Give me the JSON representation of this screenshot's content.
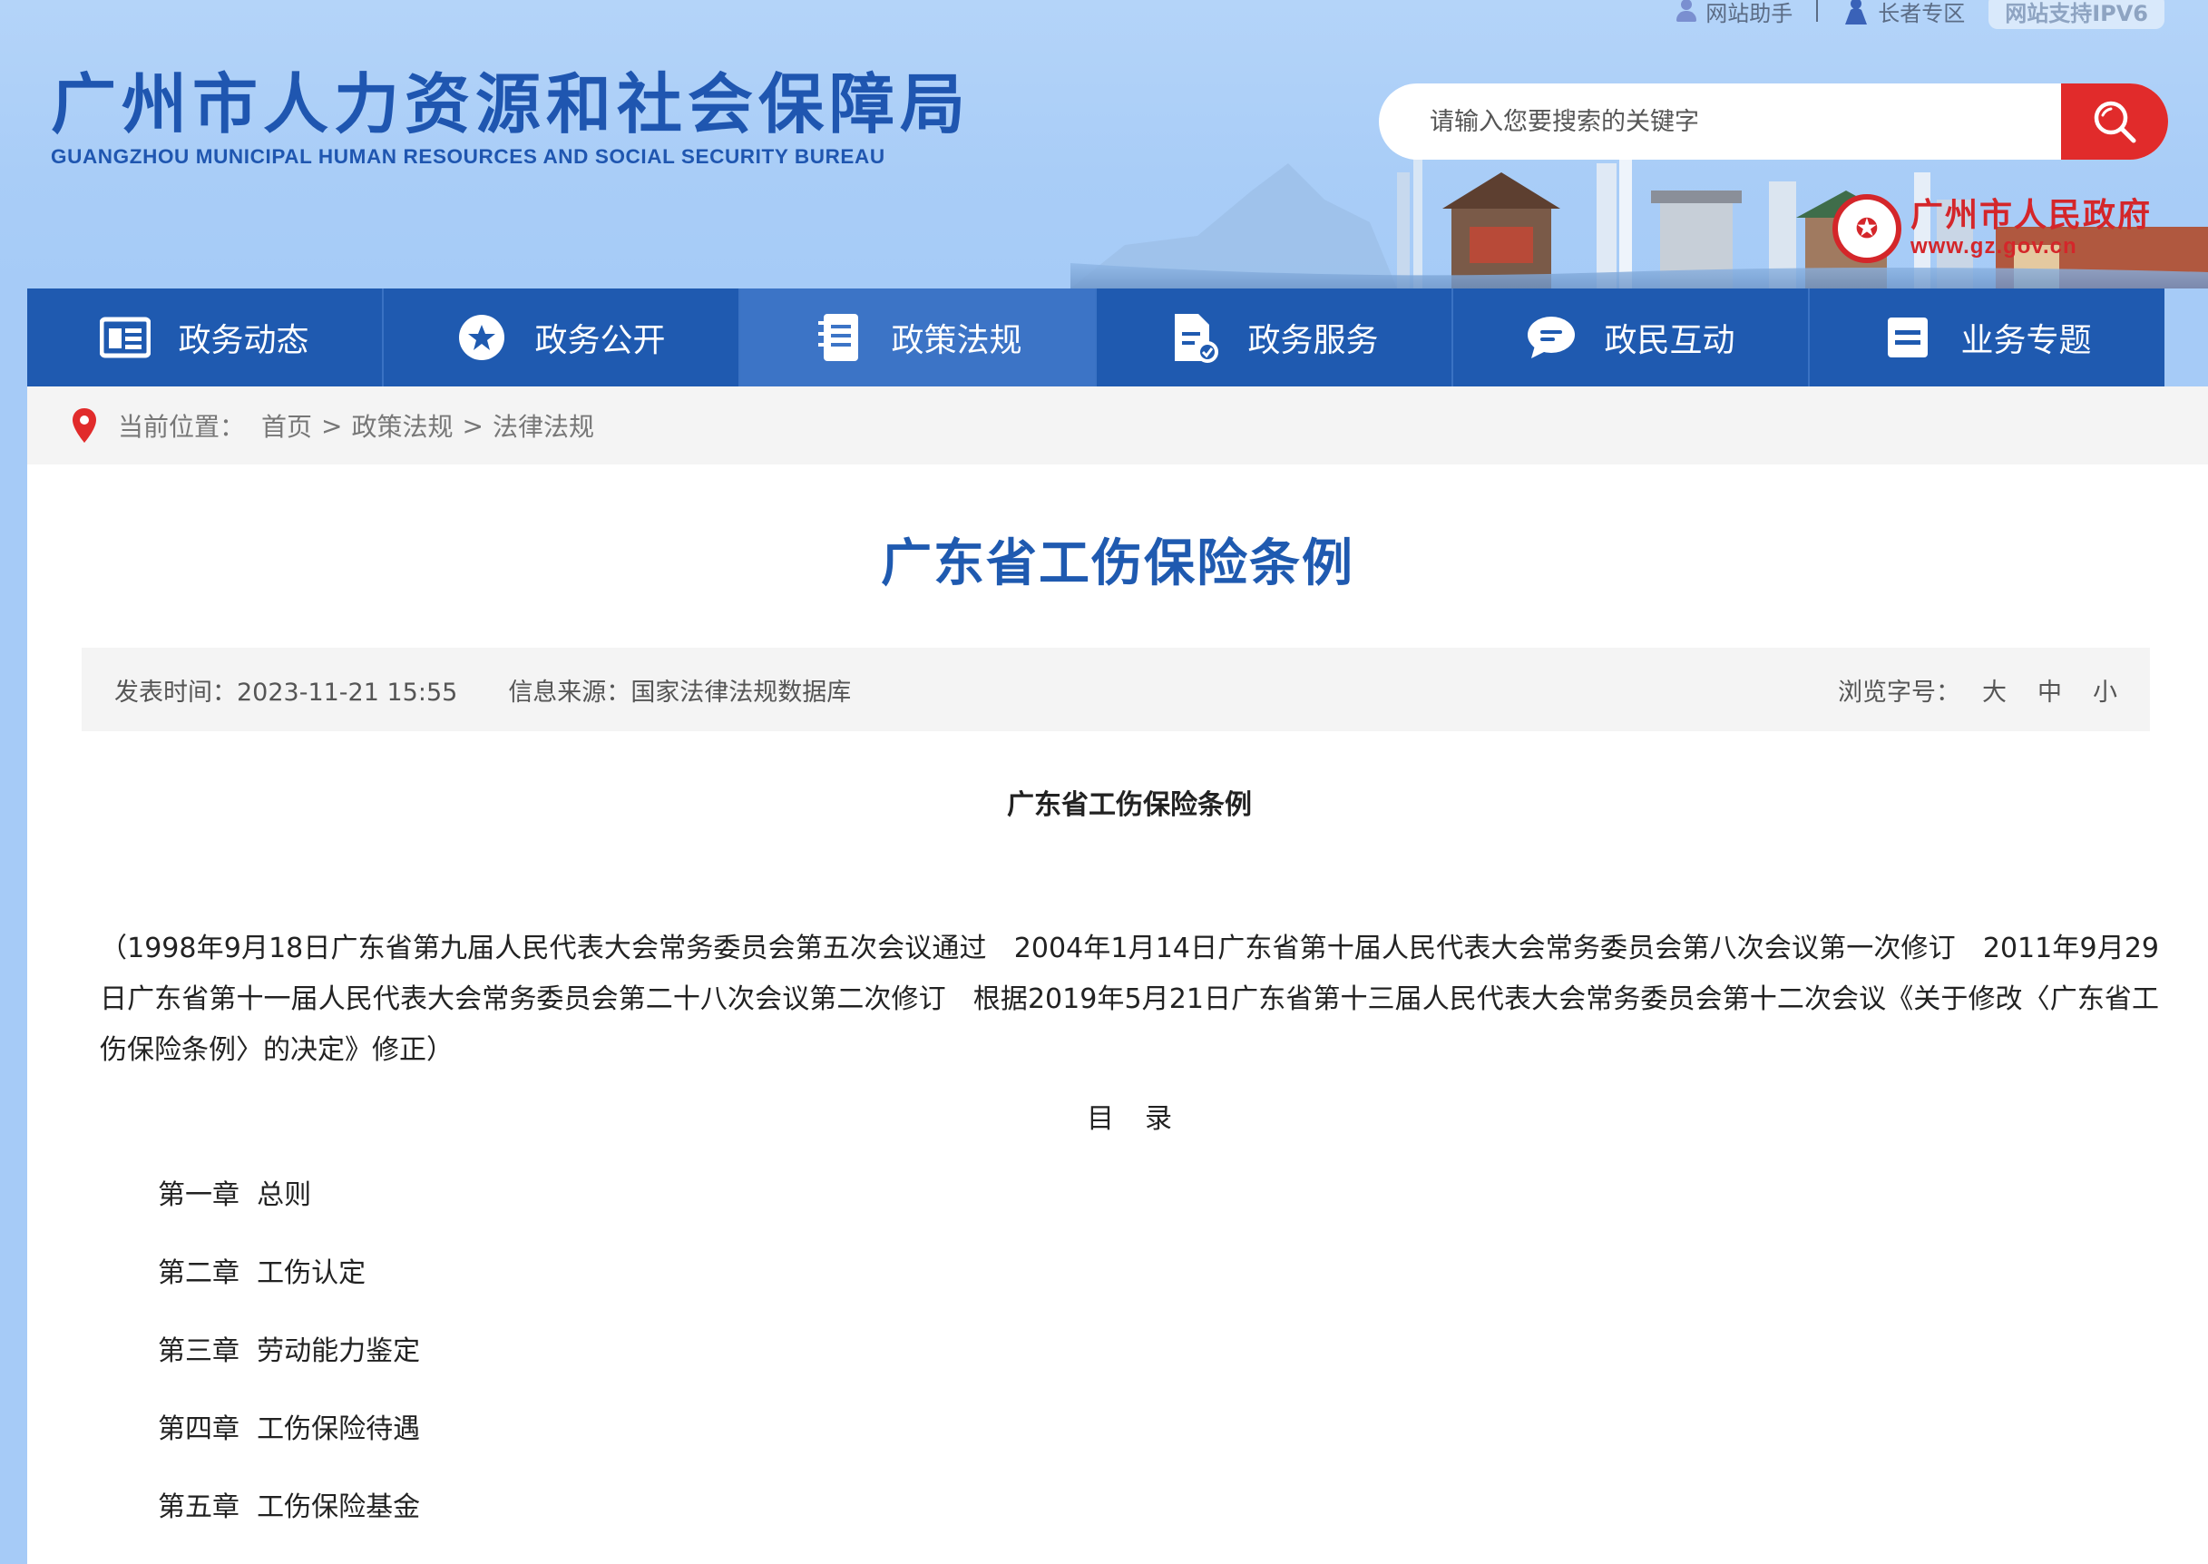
{
  "header": {
    "toplinks": {
      "assistant": "网站助手",
      "elder": "长者专区",
      "ipv6": "网站支持IPV6"
    },
    "logo_cn": "广州市人力资源和社会保障局",
    "logo_en": "GUANGZHOU MUNICIPAL HUMAN RESOURCES AND SOCIAL SECURITY BUREAU",
    "search": {
      "placeholder": "请输入您要搜索的关键字"
    },
    "gov": {
      "name": "广州市人民政府",
      "url": "www.gz.gov.cn"
    },
    "colors": {
      "brand_blue": "#1f5ab0",
      "search_red": "#e12b2b",
      "bg_blue": "#a6cbf7"
    }
  },
  "nav": {
    "items": [
      {
        "label": "政务动态",
        "icon": "newspaper-icon"
      },
      {
        "label": "政务公开",
        "icon": "star-circle-icon"
      },
      {
        "label": "政策法规",
        "icon": "document-icon"
      },
      {
        "label": "政务服务",
        "icon": "service-doc-icon"
      },
      {
        "label": "政民互动",
        "icon": "chat-bubble-icon"
      },
      {
        "label": "业务专题",
        "icon": "list-icon"
      }
    ],
    "active_index": 2
  },
  "breadcrumb": {
    "prefix": "当前位置：",
    "items": [
      "首页",
      "政策法规",
      "法律法规"
    ]
  },
  "article": {
    "title": "广东省工伤保险条例",
    "meta": {
      "publish_label": "发表时间：",
      "publish_time": "2023-11-21 15:55",
      "source_label": "信息来源：",
      "source": "国家法律法规数据库",
      "fontsize_label": "浏览字号：",
      "fontsize_options": [
        "大",
        "中",
        "小"
      ]
    },
    "doc_title": "广东省工伤保险条例",
    "preamble": "（1998年9月18日广东省第九届人民代表大会常务委员会第五次会议通过　2004年1月14日广东省第十届人民代表大会常务委员会第八次会议第一次修订　2011年9月29日广东省第十一届人民代表大会常务委员会第二十八次会议第二次修订　根据2019年5月21日广东省第十三届人民代表大会常务委员会第十二次会议《关于修改〈广东省工伤保险条例〉的决定》修正）",
    "toc_head": "目录",
    "toc": [
      {
        "chapter": "第一章",
        "name": "总则"
      },
      {
        "chapter": "第二章",
        "name": "工伤认定"
      },
      {
        "chapter": "第三章",
        "name": "劳动能力鉴定"
      },
      {
        "chapter": "第四章",
        "name": "工伤保险待遇"
      },
      {
        "chapter": "第五章",
        "name": "工伤保险基金"
      }
    ]
  }
}
